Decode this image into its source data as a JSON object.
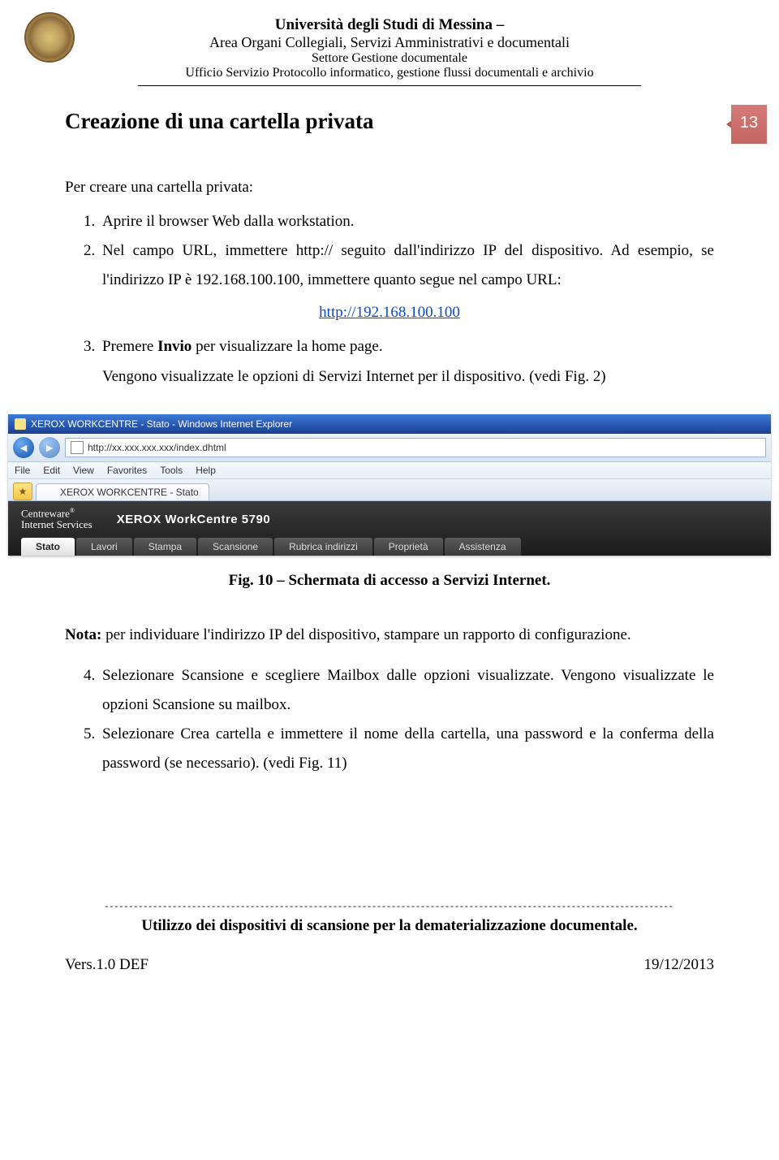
{
  "header": {
    "line1": "Università degli Studi di Messina –",
    "line2": "Area Organi Collegiali, Servizi Amministrativi e documentali",
    "line3": "Settore Gestione documentale",
    "line4": "Ufficio Servizio Protocollo informatico, gestione flussi documentali e archivio"
  },
  "page_number": "13",
  "title": "Creazione di una cartella privata",
  "intro_text": "Per creare una cartella privata:",
  "steps": {
    "s1": "Aprire il browser Web dalla workstation.",
    "s2": "Nel campo URL, immettere http:// seguito dall'indirizzo IP del dispositivo. Ad esempio, se l'indirizzo IP è 192.168.100.100, immettere quanto segue nel campo URL:",
    "url_link": "http://192.168.100.100",
    "s3_pre": "Premere ",
    "s3_bold": "Invio",
    "s3_post": " per visualizzare la home page.",
    "s3_sub": "Vengono visualizzate le opzioni di Servizi Internet per il dispositivo. (vedi Fig. 2)"
  },
  "ie": {
    "title": "XEROX WORKCENTRE - Stato - Windows Internet Explorer",
    "address": "http://xx.xxx.xxx.xxx/index.dhtml",
    "menus": [
      "File",
      "Edit",
      "View",
      "Favorites",
      "Tools",
      "Help"
    ],
    "tab_label": "XEROX WORKCENTRE - Stato",
    "brand_line1": "Centreware",
    "brand_line2": "Internet Services",
    "model": "XEROX WorkCentre 5790",
    "tabs": [
      "Stato",
      "Lavori",
      "Stampa",
      "Scansione",
      "Rubrica indirizzi",
      "Proprietà",
      "Assistenza"
    ]
  },
  "fig_caption": "Fig. 10 – Schermata di accesso a Servizi Internet.",
  "note_label": "Nota:",
  "note_text": " per individuare l'indirizzo IP del dispositivo, stampare un rapporto di configurazione.",
  "steps2": {
    "s4": "Selezionare Scansione e scegliere Mailbox dalle opzioni visualizzate. Vengono visualizzate le opzioni Scansione su mailbox.",
    "s5": "Selezionare Crea cartella e immettere il nome della cartella, una password e la conferma della password (se necessario). (vedi Fig. 11)"
  },
  "footer": {
    "dashes": "---------------------------------------------------------------------------------------------------------------------",
    "line": "Utilizzo dei dispositivi di scansione per la dematerializzazione documentale.",
    "left": "Vers.1.0 DEF",
    "right": "19/12/2013"
  }
}
